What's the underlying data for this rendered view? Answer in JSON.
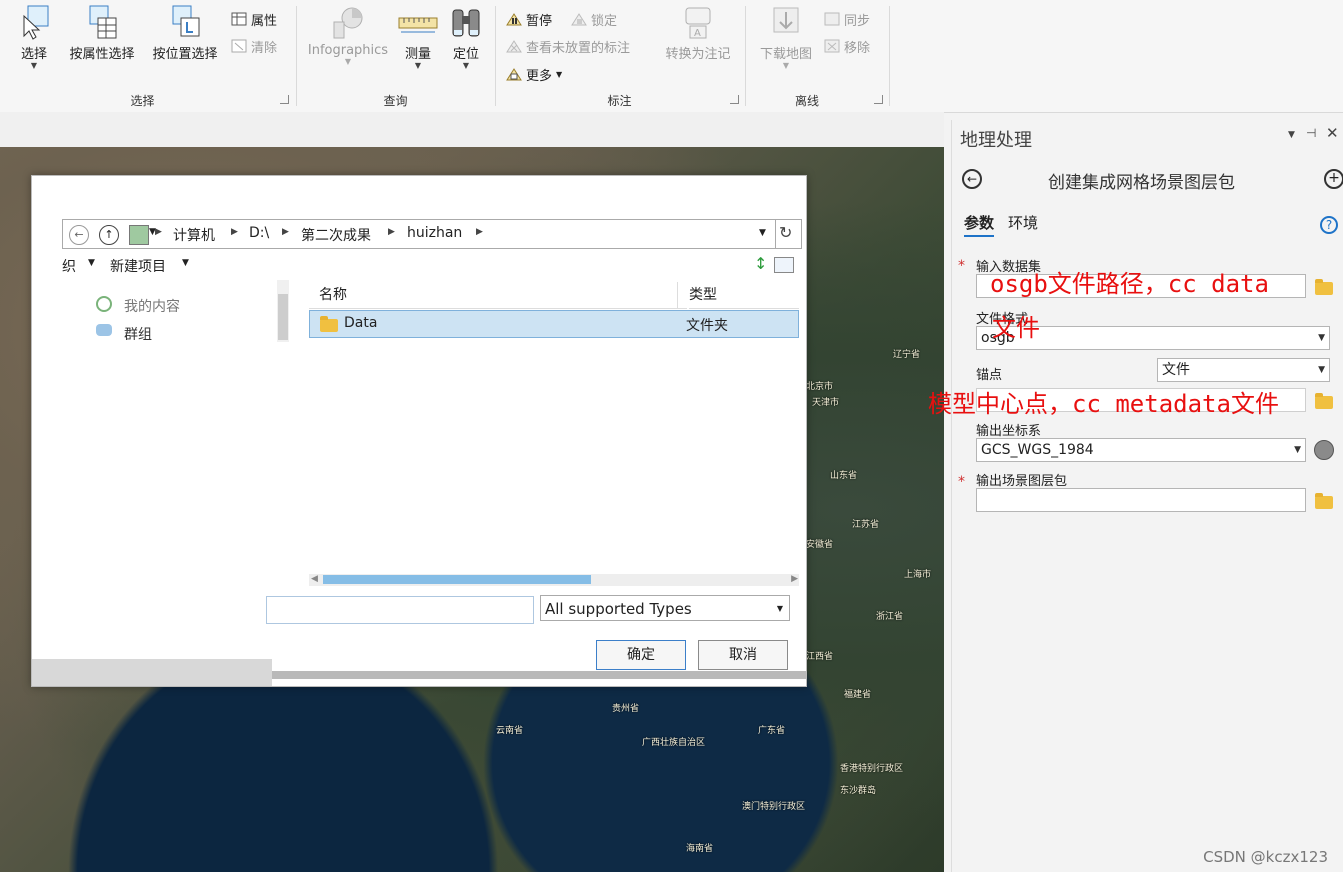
{
  "ribbon": {
    "select_group": {
      "label": "选择",
      "select": "选择",
      "select_by_attr": "按属性选择",
      "select_by_location": "按位置选择",
      "attributes": "属性",
      "clear": "清除"
    },
    "query_group": {
      "label": "查询",
      "infographics": "Infographics",
      "measure": "测量",
      "locate": "定位"
    },
    "label_group": {
      "label": "标注",
      "pause": "暂停",
      "lock": "锁定",
      "view_unplaced": "查看未放置的标注",
      "more": "更多",
      "convert": "转换为注记"
    },
    "offline_group": {
      "label": "离线",
      "download_map": "下载地图",
      "sync": "同步",
      "remove": "移除"
    }
  },
  "map_labels": [
    "北京市",
    "天津市",
    "辽宁省",
    "山东省",
    "江苏省",
    "安徽省",
    "上海市",
    "浙江省",
    "江西省",
    "福建省",
    "广东省",
    "广西壮族自治区",
    "贵州省",
    "云南省",
    "香港特别行政区",
    "澳门特别行政区",
    "东沙群岛",
    "海南省"
  ],
  "dialog": {
    "breadcrumbs": [
      "计算机",
      "D:\\",
      "第二次成果",
      "huizhan"
    ],
    "organize": "织",
    "new_item": "新建项目",
    "nav_items": [
      "我的内容",
      "群组"
    ],
    "columns": {
      "name": "名称",
      "type": "类型"
    },
    "rows": [
      {
        "name": "Data",
        "type": "文件夹"
      }
    ],
    "filename_value": "",
    "filetype": "All supported Types",
    "ok": "确定",
    "cancel": "取消"
  },
  "gp_panel": {
    "title": "地理处理",
    "tool_title": "创建集成网格场景图层包",
    "tabs": [
      "参数",
      "环境"
    ],
    "input_dataset_label": "输入数据集",
    "file_format_label": "文件格式",
    "file_format_value": "osgb",
    "anchor_label": "锚点",
    "anchor_value": "文件",
    "output_cs_label": "输出坐标系",
    "output_cs_value": "GCS_WGS_1984",
    "output_package_label": "输出场景图层包"
  },
  "annotations": {
    "input_hint_line1": "osgb文件路径，cc data",
    "input_hint_line2": "文件",
    "anchor_hint": "模型中心点，cc metadata文件"
  },
  "watermark": "CSDN @kczx123",
  "colors": {
    "annotation": "#e81010",
    "selection": "#cde3f3",
    "accent": "#1e73c8"
  }
}
